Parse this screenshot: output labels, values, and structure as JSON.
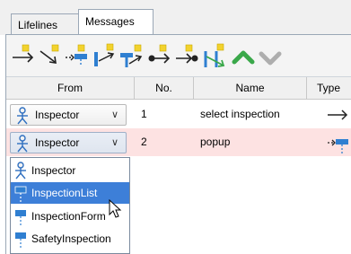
{
  "tabs": [
    {
      "label": "Lifelines",
      "active": false
    },
    {
      "label": "Messages",
      "active": true
    }
  ],
  "toolbar": {
    "tools": [
      {
        "icon": "add-message-arrow-icon"
      },
      {
        "icon": "add-self-message-icon"
      },
      {
        "icon": "add-create-message-icon"
      },
      {
        "icon": "add-return-message-icon"
      },
      {
        "icon": "add-lifeline-return-icon"
      },
      {
        "icon": "add-found-message-icon"
      },
      {
        "icon": "add-lost-message-icon"
      },
      {
        "icon": "add-reply-message-icon"
      },
      {
        "icon": "move-up-icon"
      },
      {
        "icon": "move-down-icon"
      }
    ],
    "accent": "#3aa84a"
  },
  "table": {
    "columns": [
      "From",
      "No.",
      "Name",
      "Type"
    ],
    "rows": [
      {
        "from": "Inspector",
        "no": "1",
        "name": "select inspection",
        "type_icon": "sync-arrow-icon"
      },
      {
        "from": "Inspector",
        "no": "2",
        "name": "popup",
        "type_icon": "create-message-icon"
      }
    ],
    "selected_row_color": "#fde2e2"
  },
  "dropdown": {
    "items": [
      {
        "label": "Inspector",
        "icon": "actor-icon",
        "selected": false
      },
      {
        "label": "InspectionList",
        "icon": "boundary-icon",
        "selected": true
      },
      {
        "label": "InspectionForm",
        "icon": "boundary-icon",
        "selected": false
      },
      {
        "label": "SafetyInspection",
        "icon": "boundary-icon",
        "selected": false
      }
    ],
    "selected_color": "#3d7fd8"
  }
}
